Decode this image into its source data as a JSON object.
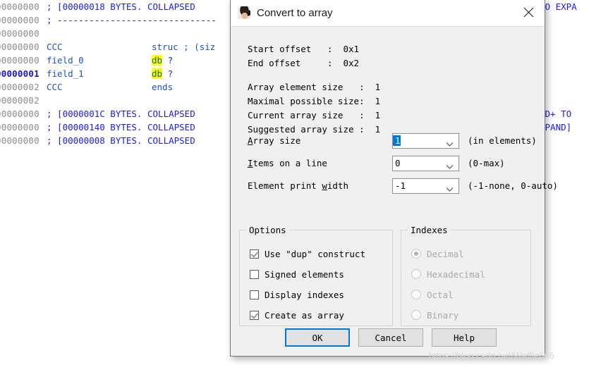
{
  "ida": {
    "lines": [
      {
        "addr": "00000000",
        "current": false,
        "kind": "comment",
        "comment": "; [00000018 BYTES. COLLAPSED",
        "right": "TO EXPA"
      },
      {
        "addr": "00000000",
        "current": false,
        "kind": "dash",
        "comment": "; ------------------------------",
        "right": ""
      },
      {
        "addr": "00000000",
        "current": false,
        "kind": "blank",
        "comment": "",
        "right": ""
      },
      {
        "addr": "00000000",
        "current": false,
        "kind": "struct",
        "name": "CCC",
        "keyword": "struc ; (siz",
        "right": ""
      },
      {
        "addr": "00000000",
        "current": false,
        "kind": "field",
        "name": "field_0",
        "keyword": "db",
        "operand": "?",
        "right": ""
      },
      {
        "addr": "00000001",
        "current": true,
        "kind": "field",
        "name": "field_1",
        "keyword": "db",
        "operand": "?",
        "right": ""
      },
      {
        "addr": "00000002",
        "current": false,
        "kind": "ends",
        "name": "CCC",
        "keyword": "ends",
        "right": ""
      },
      {
        "addr": "00000002",
        "current": false,
        "kind": "blank",
        "comment": "",
        "right": ""
      },
      {
        "addr": "00000000",
        "current": false,
        "kind": "comment",
        "comment": "; [0000001C BYTES. COLLAPSED",
        "right": "AD+ TO"
      },
      {
        "addr": "00000000",
        "current": false,
        "kind": "comment",
        "comment": "; [00000140 BYTES. COLLAPSED",
        "right": "XPAND]"
      },
      {
        "addr": "00000000",
        "current": false,
        "kind": "comment",
        "comment": "; [00000008 BYTES. COLLAPSED",
        "right": ""
      }
    ]
  },
  "dialog": {
    "title": "Convert to array",
    "title_icon": "avatar-icon",
    "close_icon": "close-icon",
    "info": [
      {
        "label": "Start offset   :",
        "value": "0x1"
      },
      {
        "label": "End offset     :",
        "value": "0x2"
      },
      {
        "label": "Array element size   :",
        "value": "1"
      },
      {
        "label": "Maximal possible size:",
        "value": "1"
      },
      {
        "label": "Current array size   :",
        "value": "1"
      },
      {
        "label": "Suggested array size :",
        "value": "1"
      }
    ],
    "fields": [
      {
        "label_pre": "",
        "label_accel": "A",
        "label_post": "rray size",
        "value": "1",
        "selected": true,
        "hint": "(in elements)",
        "arrow_icon": "chevron-down-icon"
      },
      {
        "label_pre": "",
        "label_accel": "I",
        "label_post": "tems on a line",
        "value": "0",
        "selected": false,
        "hint": "(0-max)",
        "arrow_icon": "chevron-down-icon"
      },
      {
        "label_pre": "Element print ",
        "label_accel": "w",
        "label_post": "idth",
        "value": "-1",
        "selected": false,
        "hint": "(-1-none, 0-auto)",
        "arrow_icon": "chevron-down-icon"
      }
    ],
    "options_group": {
      "title": "Options",
      "items": [
        {
          "label": "Use \"dup\" construct",
          "checked": true
        },
        {
          "label": "Signed elements",
          "checked": false
        },
        {
          "label": "Display indexes",
          "checked": false
        },
        {
          "label": "Create as array",
          "checked": true
        }
      ]
    },
    "indexes_group": {
      "title": "Indexes",
      "disabled": true,
      "items": [
        {
          "label": "Decimal",
          "checked": true
        },
        {
          "label": "Hexadecimal",
          "checked": false
        },
        {
          "label": "Octal",
          "checked": false
        },
        {
          "label": "Binary",
          "checked": false
        }
      ]
    },
    "buttons": {
      "ok": "OK",
      "cancel": "Cancel",
      "help": "Help"
    }
  },
  "watermark": "https://blog.csdn.net/Waffle666",
  "colors": {
    "accent": "#0078d7",
    "dialog_bg": "#f0f0f0",
    "highlight": "#ffff00",
    "comment_blue": "#1a1afa",
    "addr_gray": "#8c8c8c"
  }
}
